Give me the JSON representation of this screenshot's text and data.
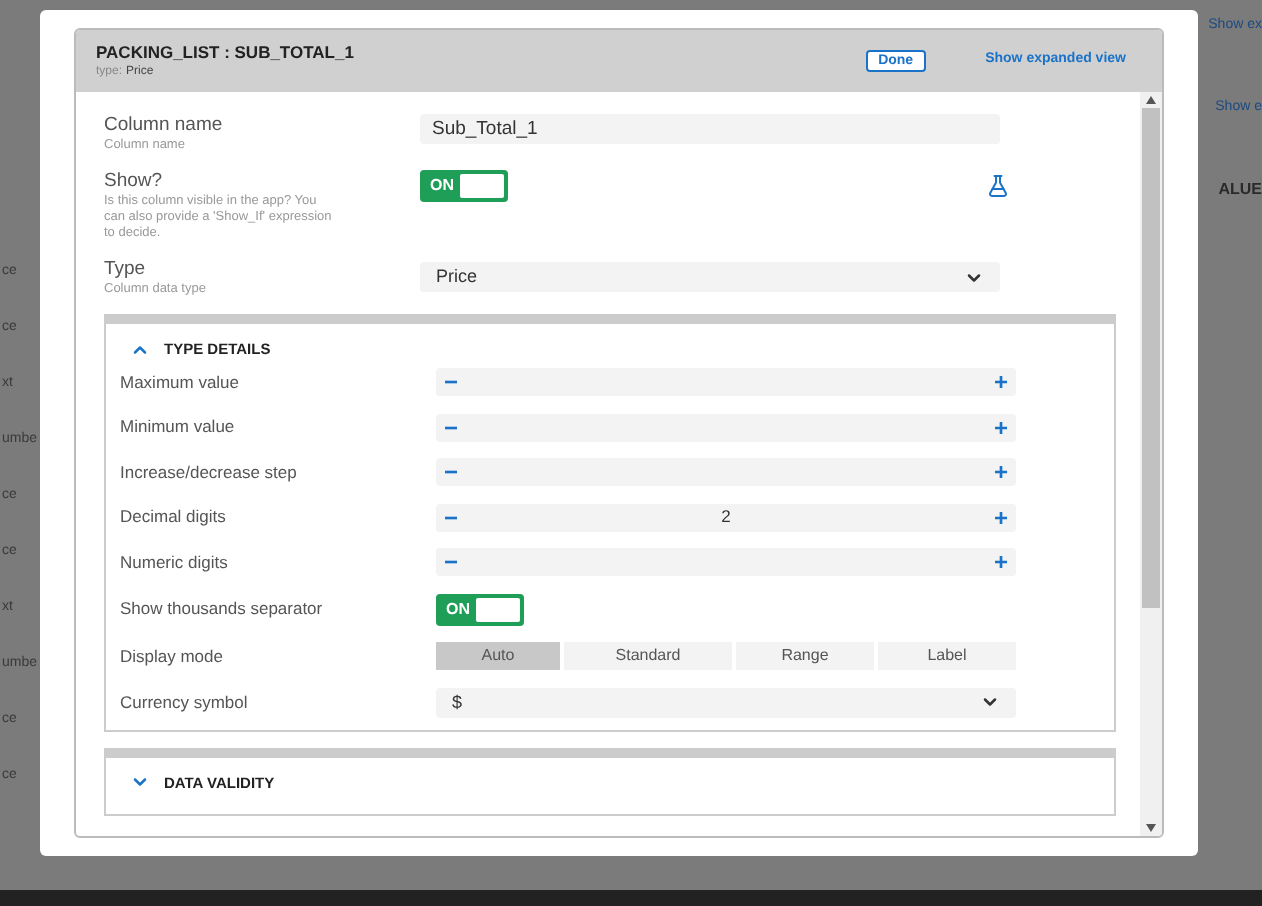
{
  "background": {
    "left_fragments": [
      "ce",
      "ce",
      "xt",
      "umbe",
      "ce",
      "ce",
      "xt",
      "umbe",
      "ce",
      "ce"
    ],
    "right_links": [
      "Show ex",
      "Show e"
    ],
    "right_header": "ALUE"
  },
  "dialog": {
    "title": "PACKING_LIST : SUB_TOTAL_1",
    "type_label": "type:",
    "type_value": "Price",
    "done_button": "Done",
    "expand_link": "Show expanded view"
  },
  "fields": [
    {
      "kind": "text",
      "label": "Column name",
      "hint": "Column name",
      "value": "Sub_Total_1"
    },
    {
      "kind": "toggle",
      "label": "Show?",
      "hint": "Is this column visible in the app? You can also provide a 'Show_If' expression to decide.",
      "on": true,
      "toggle_text": "ON"
    },
    {
      "kind": "select",
      "label": "Type",
      "hint": "Column data type",
      "value": "Price"
    }
  ],
  "sections": [
    {
      "title": "TYPE DETAILS",
      "expanded": true,
      "rows": [
        {
          "kind": "stepper",
          "label": "Maximum value",
          "minus": "−",
          "plus": "+"
        },
        {
          "kind": "stepper",
          "label": "Minimum value",
          "minus": "−",
          "plus": "+"
        },
        {
          "kind": "stepper",
          "label": "Increase/decrease step",
          "minus": "−",
          "plus": "+"
        },
        {
          "kind": "stepper",
          "label": "Decimal digits",
          "value": "2",
          "minus": "−",
          "plus": "+"
        },
        {
          "kind": "stepper",
          "label": "Numeric digits",
          "minus": "−",
          "plus": "+"
        },
        {
          "kind": "toggle",
          "label": "Show thousands separator",
          "on": true,
          "toggle_text": "ON"
        },
        {
          "kind": "segments",
          "label": "Display mode",
          "options": [
            {
              "label": "Auto",
              "selected": true
            },
            {
              "label": "Standard",
              "selected": false
            },
            {
              "label": "Range",
              "selected": false
            },
            {
              "label": "Label",
              "selected": false
            }
          ]
        },
        {
          "kind": "select",
          "label": "Currency symbol",
          "value": "$"
        }
      ]
    },
    {
      "title": "DATA VALIDITY",
      "expanded": false
    }
  ]
}
